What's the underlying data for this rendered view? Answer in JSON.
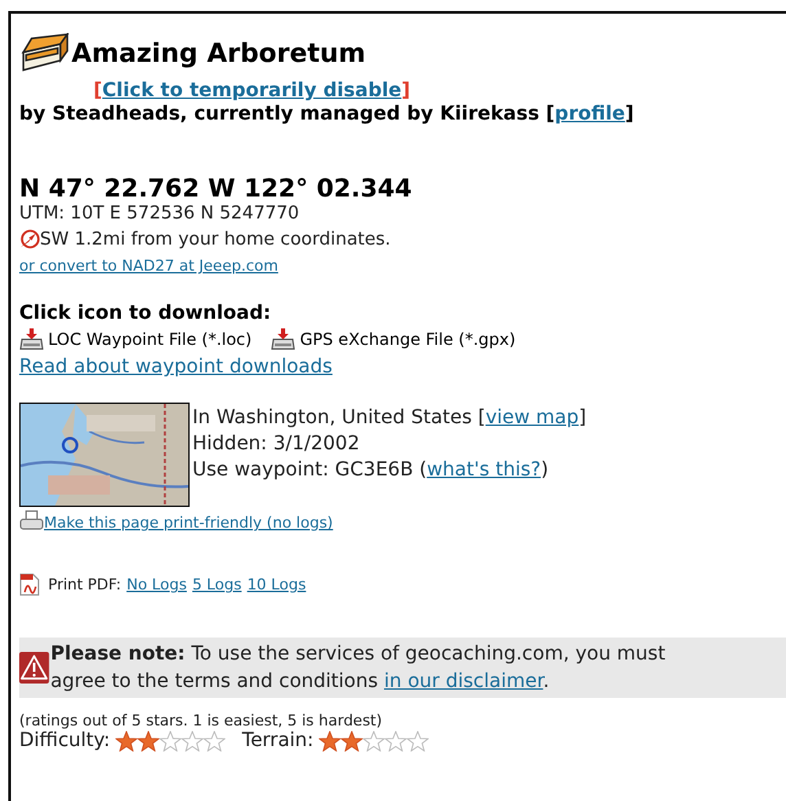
{
  "header": {
    "title": "Amazing Arboretum",
    "disable": [
      {
        "text": "["
      },
      {
        "link": "Click to temporarily disable"
      },
      {
        "text": "]"
      }
    ],
    "owner": [
      {
        "text": "by Steadheads, currently managed by Kiirekass ["
      },
      {
        "link": "profile"
      },
      {
        "text": "]"
      }
    ]
  },
  "coordinates": {
    "latlon": "N 47° 22.762 W 122° 02.344",
    "utm": "UTM: 10T E 572536 N 5247770",
    "distance": "SW 1.2mi from your home coordinates.",
    "convert_link": "or convert to NAD27 at Jeeep.com"
  },
  "downloads": {
    "heading": "Click icon to download:",
    "files": [
      "LOC Waypoint File (*.loc)",
      "GPS eXchange File (*.gpx)"
    ],
    "read_link": "Read about waypoint downloads"
  },
  "location": {
    "place": [
      {
        "text": "In Washington, United States ["
      },
      {
        "link": "view map"
      },
      {
        "text": "]"
      }
    ],
    "hidden": "Hidden: 3/1/2002",
    "waypoint": [
      {
        "text": "Use waypoint: GC3E6B ("
      },
      {
        "link": "what's this?"
      },
      {
        "text": ")"
      }
    ]
  },
  "print_link": "Make this page print-friendly (no logs)",
  "pdf": {
    "label": "Print PDF:",
    "links": [
      "No Logs",
      "5 Logs",
      "10 Logs"
    ]
  },
  "notice": {
    "text": "**Please note:** To use the services of geocaching.com, you must agree to the terms and conditions ",
    "link": "in our disclaimer",
    "end": "."
  },
  "ratings": {
    "note": "(ratings out of 5 stars. 1 is easiest, 5 is hardest)",
    "items": [
      {
        "label": "Difficulty:",
        "stars": 2
      },
      {
        "label": "Terrain:",
        "stars": 2
      }
    ]
  }
}
